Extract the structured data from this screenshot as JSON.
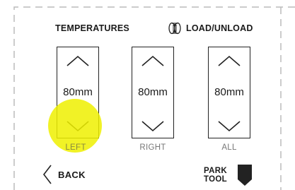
{
  "tabs": {
    "temperatures": "TEMPERATURES",
    "load_unload": "LOAD/UNLOAD",
    "load_unload_icon": "filament-spool-icon"
  },
  "panels": [
    {
      "value": "80mm",
      "caption": "LEFT"
    },
    {
      "value": "80mm",
      "caption": "RIGHT"
    },
    {
      "value": "80mm",
      "caption": "ALL"
    }
  ],
  "footer": {
    "back_label": "BACK",
    "park_label_line1": "PARK",
    "park_label_line2": "TOOL"
  },
  "colors": {
    "highlight": "#eef000",
    "border": "#222222",
    "caption": "#777777",
    "dash": "#bbbbbb"
  }
}
